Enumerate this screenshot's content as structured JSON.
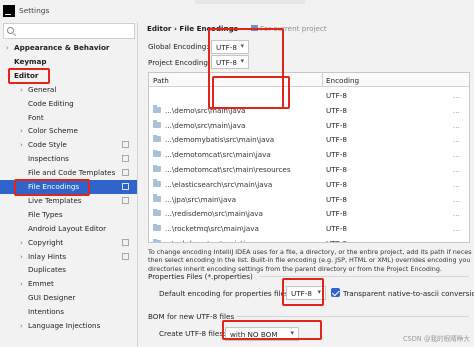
{
  "window": {
    "title": "Settings"
  },
  "sidebar": {
    "search_placeholder": "",
    "items": [
      {
        "label": "Appearance & Behavior",
        "arrow": "›",
        "bold": true
      },
      {
        "label": "Keymap",
        "arrow": "",
        "bold": true
      },
      {
        "label": "Editor",
        "arrow": "⌄",
        "bold": true
      },
      {
        "label": "General",
        "arrow": "›"
      },
      {
        "label": "Code Editing",
        "arrow": ""
      },
      {
        "label": "Font",
        "arrow": ""
      },
      {
        "label": "Color Scheme",
        "arrow": "›"
      },
      {
        "label": "Code Style",
        "arrow": "›"
      },
      {
        "label": "Inspections",
        "arrow": ""
      },
      {
        "label": "File and Code Templates",
        "arrow": ""
      },
      {
        "label": "File Encodings",
        "arrow": "",
        "selected": true
      },
      {
        "label": "Live Templates",
        "arrow": ""
      },
      {
        "label": "File Types",
        "arrow": ""
      },
      {
        "label": "Android Layout Editor",
        "arrow": ""
      },
      {
        "label": "Copyright",
        "arrow": "›"
      },
      {
        "label": "Inlay Hints",
        "arrow": "›"
      },
      {
        "label": "Duplicates",
        "arrow": ""
      },
      {
        "label": "Emmet",
        "arrow": "›"
      },
      {
        "label": "GUI Designer",
        "arrow": ""
      },
      {
        "label": "Intentions",
        "arrow": ""
      },
      {
        "label": "Language Injections",
        "arrow": "›"
      }
    ]
  },
  "main": {
    "breadcrumb": "Editor  ›  File Encodings",
    "breadcrumb_hint": "For current project",
    "global_encoding": {
      "label": "Global Encoding:",
      "value": "UTF-8"
    },
    "project_encoding": {
      "label": "Project Encoding:",
      "value": "UTF-8"
    },
    "table": {
      "col_path": "Path",
      "col_encoding": "Encoding",
      "rows": [
        {
          "path": "",
          "encoding": "UTF-8"
        },
        {
          "path": "...\\demo\\src\\main\\java",
          "encoding": "UTF-8"
        },
        {
          "path": "...\\demo\\src\\main\\java",
          "encoding": "UTF-8"
        },
        {
          "path": "...\\demomybatis\\src\\main\\java",
          "encoding": "UTF-8"
        },
        {
          "path": "...\\demotomcat\\src\\main\\java",
          "encoding": "UTF-8"
        },
        {
          "path": "...\\demotomcat\\src\\main\\resources",
          "encoding": "UTF-8"
        },
        {
          "path": "...\\elasticsearch\\src\\main\\java",
          "encoding": "UTF-8"
        },
        {
          "path": "...\\jpa\\src\\main\\java",
          "encoding": "UTF-8"
        },
        {
          "path": "...\\redisdemo\\src\\main\\java",
          "encoding": "UTF-8"
        },
        {
          "path": "...\\rocketmq\\src\\main\\java",
          "encoding": "UTF-8"
        },
        {
          "path": "...\\solrdemo\\src\\main\\java",
          "encoding": "UTF-8"
        }
      ],
      "dots": "..."
    },
    "description": [
      "To change encoding IntelliJ IDEA uses for a file, a directory, or the entire project, add its path if necessary and",
      "then select encoding in the list. Built-in file encoding (e.g. JSP, HTML or XML) overrides encoding you specify here. If not,",
      "directories inherit encoding settings from the parent directory or from the Project Encoding."
    ],
    "properties": {
      "section_title": "Properties Files (*.properties)",
      "default_label": "Default encoding for properties files:",
      "default_value": "UTF-8",
      "transparent_label": "Transparent native-to-ascii conversion",
      "transparent_checked": true
    },
    "bom": {
      "section_title": "BOM for new UTF-8 files",
      "create_label": "Create UTF-8 files:",
      "create_value": "with NO BOM"
    }
  },
  "watermark": "CSDN @我的眼睛睁大",
  "colors": {
    "accent": "#2f65ca",
    "highlight": "#e3241b"
  }
}
